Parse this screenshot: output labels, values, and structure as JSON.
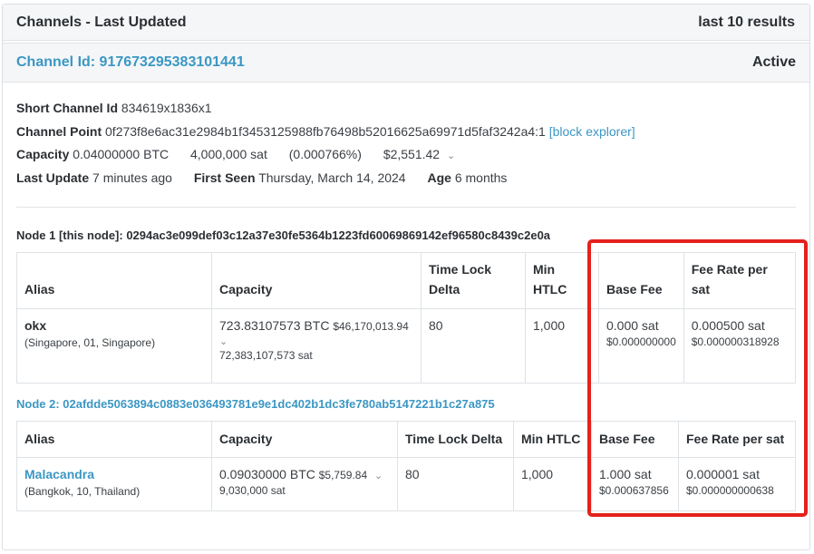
{
  "panel": {
    "title": "Channels - Last Updated",
    "results": "last 10 results"
  },
  "channel": {
    "id_text": "Channel Id: 917673295383101441",
    "status": "Active",
    "short_id_label": "Short Channel Id",
    "short_id": "834619x1836x1",
    "point_label": "Channel Point",
    "point": "0f273f8e6ac31e2984b1f3453125988fb76498b52016625a69971d5faf3242a4:1",
    "explorer_link": "[block explorer]",
    "capacity_label": "Capacity",
    "capacity_btc": "0.04000000 BTC",
    "capacity_sat": "4,000,000 sat",
    "capacity_pct": "(0.000766%)",
    "capacity_usd": "$2,551.42",
    "last_update_label": "Last Update",
    "last_update": "7 minutes ago",
    "first_seen_label": "First Seen",
    "first_seen": "Thursday, March 14, 2024",
    "age_label": "Age",
    "age": "6 months"
  },
  "node1": {
    "title": "Node 1 [this node]: 0294ac3e099def03c12a37e30fe5364b1223fd60069869142ef96580c8439c2e0a",
    "headers": {
      "alias": "Alias",
      "capacity": "Capacity",
      "time_lock": "Time Lock Delta",
      "min_htlc": "Min HTLC",
      "base_fee": "Base Fee",
      "fee_rate": "Fee Rate per sat"
    },
    "row": {
      "alias": "okx",
      "location": "(Singapore, 01, Singapore)",
      "capacity_btc": "723.83107573 BTC",
      "capacity_usd": "$46,170,013.94",
      "capacity_sat": "72,383,107,573 sat",
      "time_lock": "80",
      "min_htlc": "1,000",
      "base_fee": "0.000 sat",
      "base_fee_usd": "$0.000000000",
      "fee_rate": "0.000500 sat",
      "fee_rate_usd": "$0.000000318928"
    }
  },
  "node2": {
    "title": "Node 2: 02afdde5063894c0883e036493781e9e1dc402b1dc3fe780ab5147221b1c27a875",
    "headers": {
      "alias": "Alias",
      "capacity": "Capacity",
      "time_lock": "Time Lock Delta",
      "min_htlc": "Min HTLC",
      "base_fee": "Base Fee",
      "fee_rate": "Fee Rate per sat"
    },
    "row": {
      "alias": "Malacandra",
      "location": "(Bangkok, 10, Thailand)",
      "capacity_btc": "0.09030000 BTC",
      "capacity_usd": "$5,759.84",
      "capacity_sat": "9,030,000 sat",
      "time_lock": "80",
      "min_htlc": "1,000",
      "base_fee": "1.000 sat",
      "base_fee_usd": "$0.000637856",
      "fee_rate": "0.000001 sat",
      "fee_rate_usd": "$0.000000000638"
    }
  },
  "colors": {
    "link": "#3b97c4",
    "highlight": "#e4211c"
  },
  "icons": {
    "expand": "chevron-down-icon"
  }
}
